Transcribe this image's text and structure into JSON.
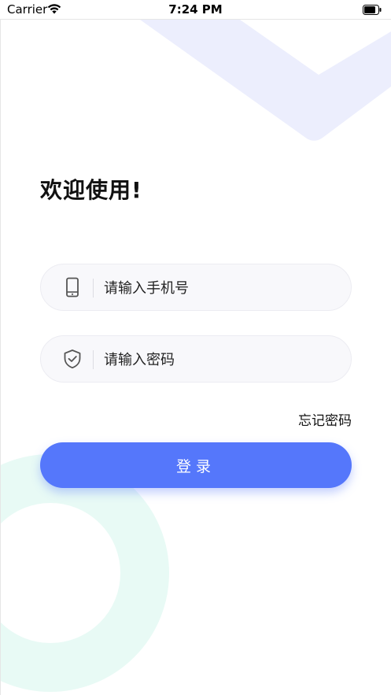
{
  "status_bar": {
    "carrier": "Carrier",
    "time": "7:24 PM"
  },
  "welcome": {
    "title": "欢迎使用!"
  },
  "form": {
    "phone_placeholder": "请输入手机号",
    "password_placeholder": "请输入密码",
    "forgot_label": "忘记密码",
    "login_label": "登录"
  },
  "colors": {
    "accent": "#5577fb",
    "deco_top": "#eceefd",
    "deco_bottom": "#e8faf5",
    "input_bg": "#f8f8fb"
  },
  "icons": {
    "phone": "phone-icon",
    "password": "shield-check-icon",
    "wifi": "wifi-icon",
    "battery": "battery-icon"
  }
}
